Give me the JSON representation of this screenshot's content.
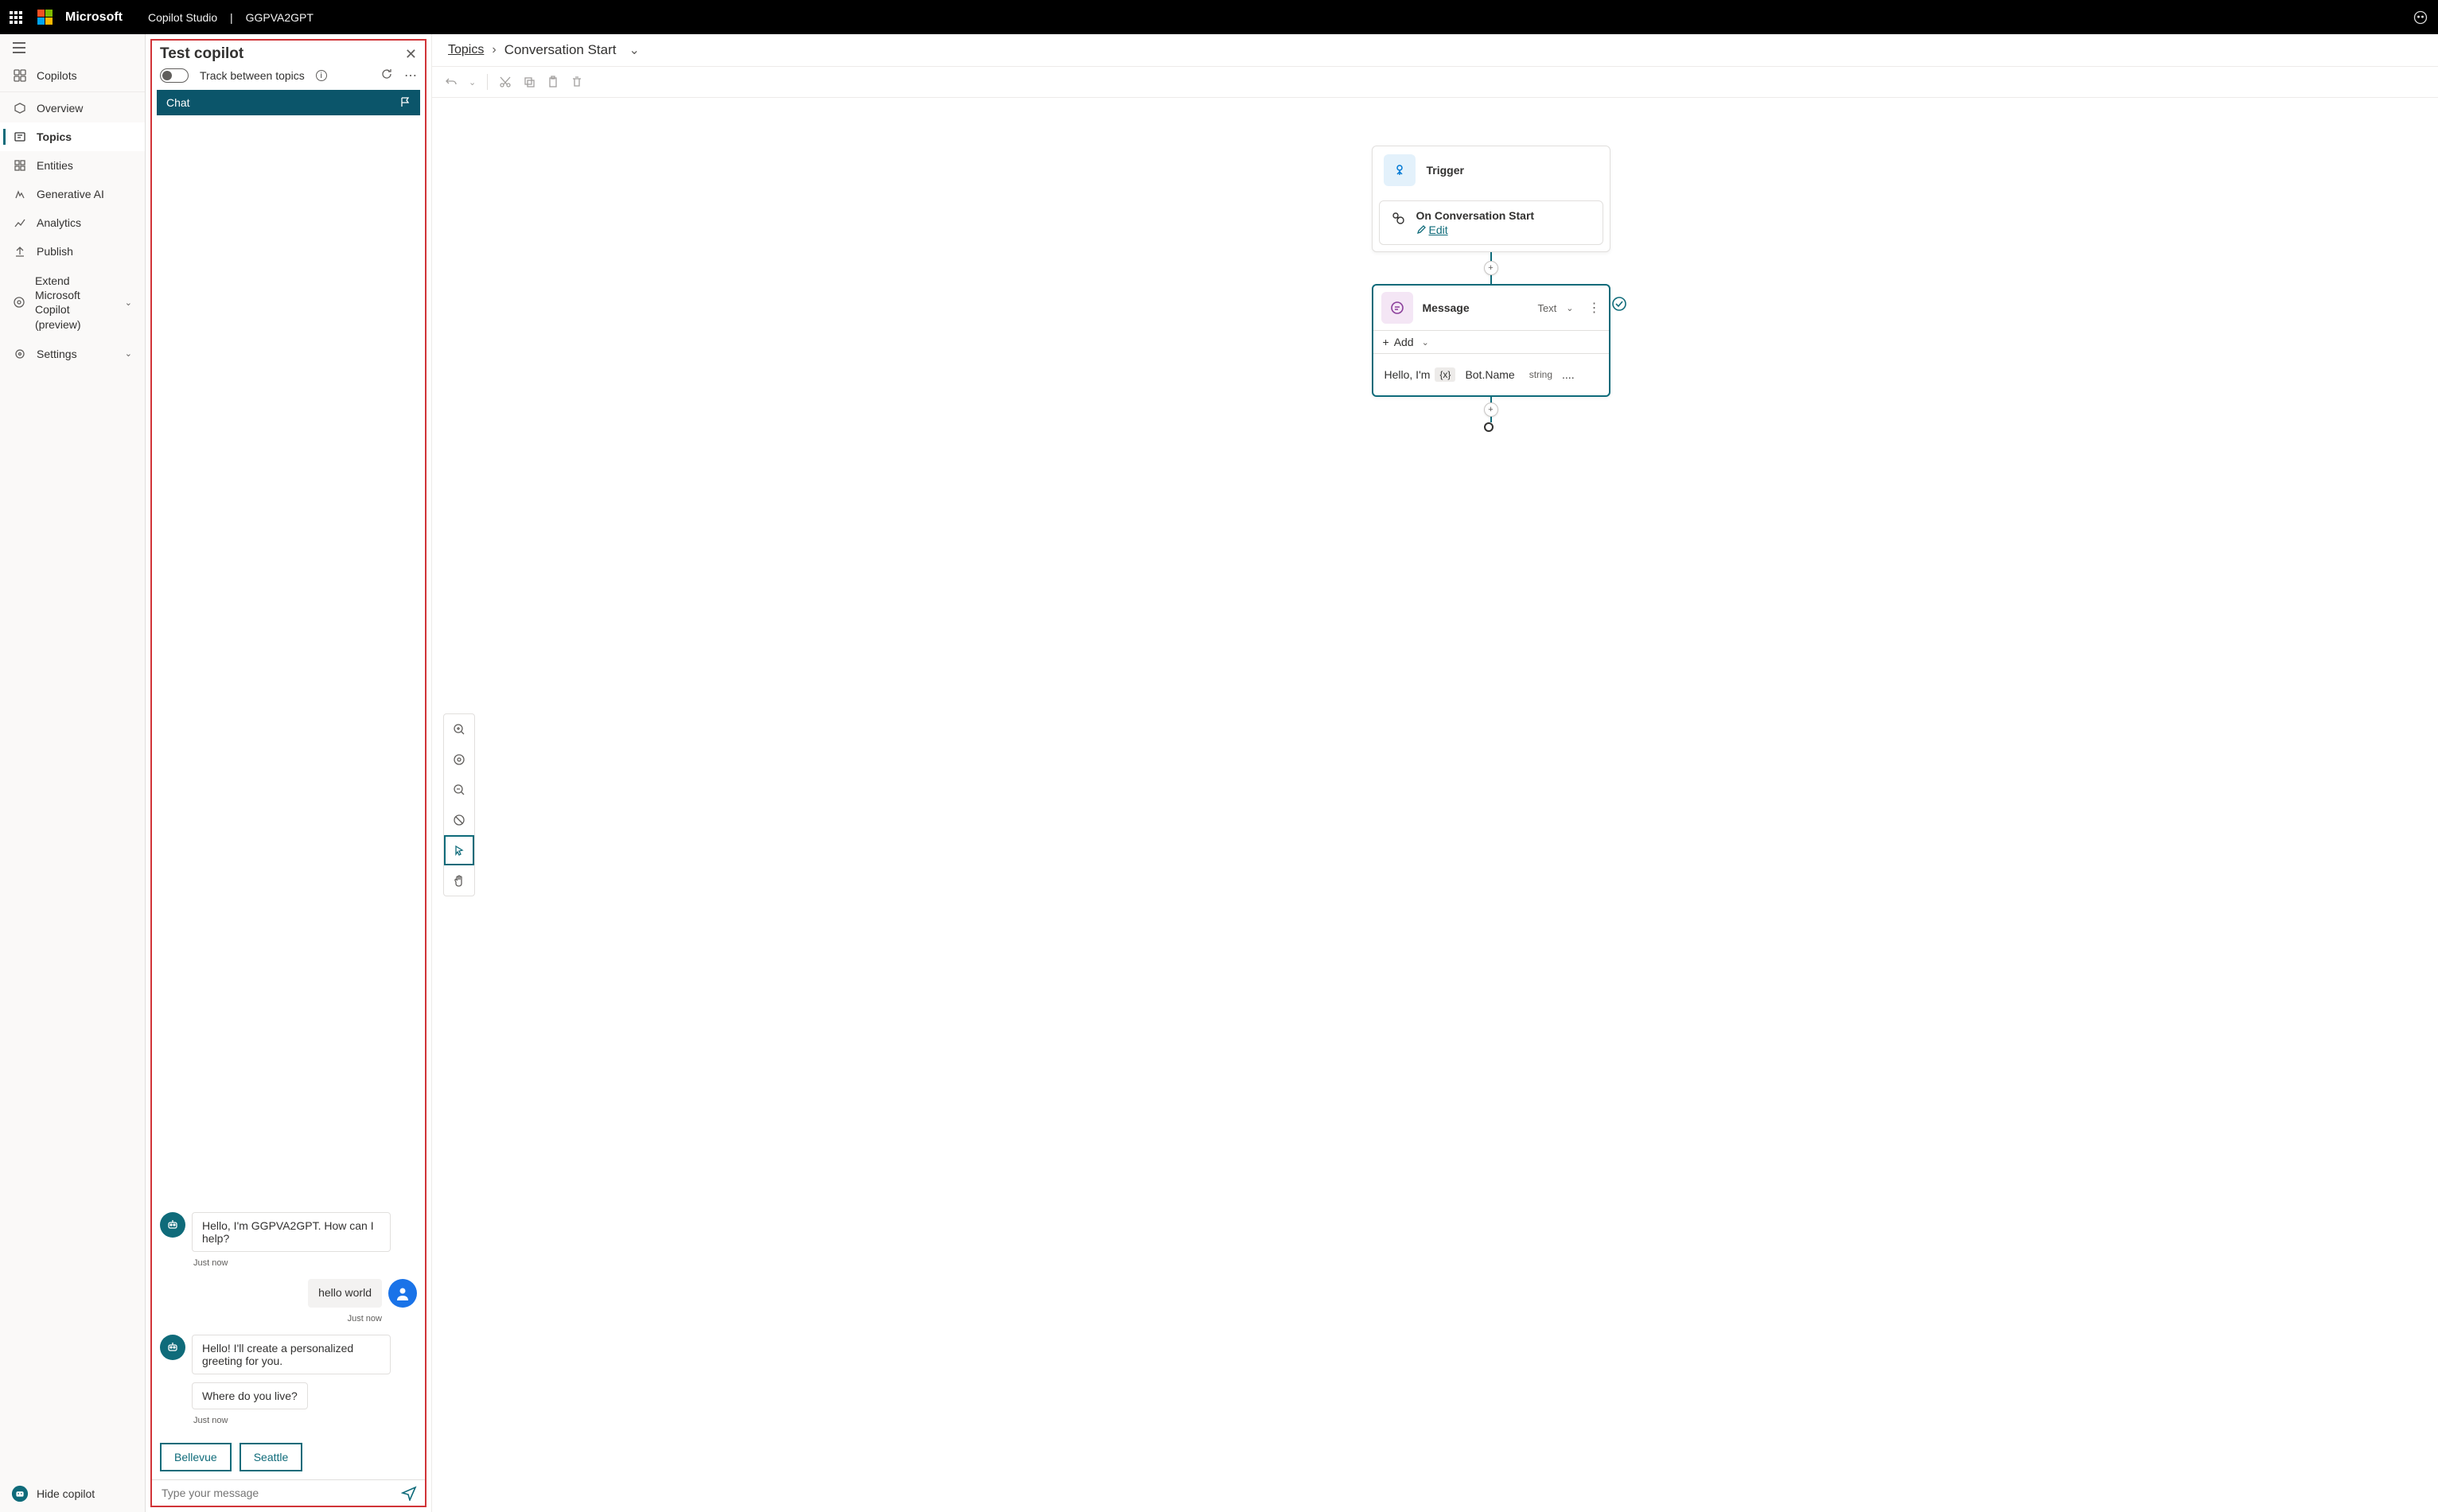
{
  "topbar": {
    "brand": "Microsoft",
    "app": "Copilot Studio",
    "project": "GGPVA2GPT"
  },
  "leftnav": {
    "items": [
      {
        "label": "Copilots",
        "icon": "copilots"
      },
      {
        "label": "Overview",
        "icon": "overview"
      },
      {
        "label": "Topics",
        "icon": "topics",
        "selected": true
      },
      {
        "label": "Entities",
        "icon": "entities"
      },
      {
        "label": "Generative AI",
        "icon": "genai"
      },
      {
        "label": "Analytics",
        "icon": "analytics"
      },
      {
        "label": "Publish",
        "icon": "publish"
      },
      {
        "label": "Extend Microsoft Copilot (preview)",
        "icon": "extend",
        "chevron": true
      },
      {
        "label": "Settings",
        "icon": "settings",
        "chevron": true
      }
    ],
    "footer": "Hide copilot"
  },
  "testPanel": {
    "title": "Test copilot",
    "trackLabel": "Track between topics",
    "chatHeader": "Chat",
    "messages": [
      {
        "role": "bot",
        "text": "Hello, I'm GGPVA2GPT. How can I help?",
        "ts": "Just now"
      },
      {
        "role": "user",
        "text": "hello world",
        "ts": "Just now"
      },
      {
        "role": "bot",
        "text": "Hello! I'll create a personalized greeting for you.",
        "ts": ""
      },
      {
        "role": "bot",
        "text": "Where do you live?",
        "ts": "Just now"
      }
    ],
    "quickReplies": [
      "Bellevue",
      "Seattle"
    ],
    "composerPlaceholder": "Type your message"
  },
  "canvas": {
    "breadcrumb": {
      "root": "Topics",
      "leaf": "Conversation Start"
    },
    "triggerNode": {
      "title": "Trigger",
      "eventLabel": "On Conversation Start",
      "editLabel": "Edit"
    },
    "messageNode": {
      "title": "Message",
      "typeLabel": "Text",
      "addLabel": "Add",
      "prefixText": "Hello, I'm",
      "varBadge": "{x}",
      "varName": "Bot.Name",
      "varType": "string",
      "suffixText": "...."
    }
  }
}
